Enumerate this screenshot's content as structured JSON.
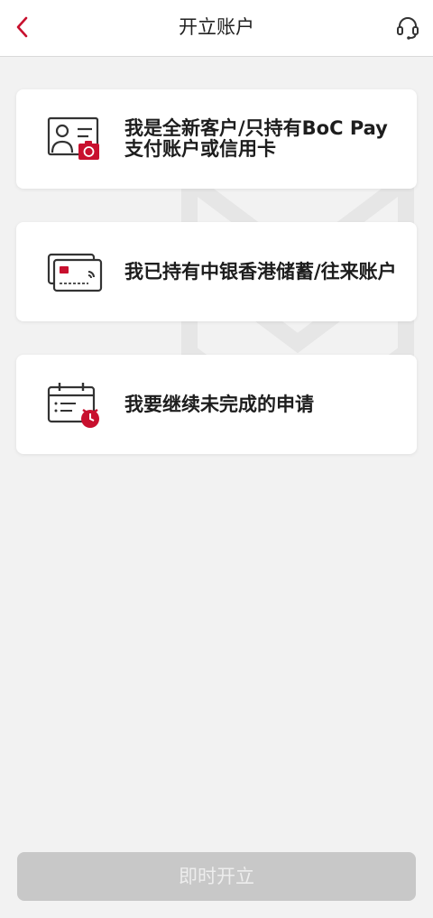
{
  "header": {
    "title": "开立账户",
    "back_icon": "chevron-left-icon",
    "support_icon": "headset-icon"
  },
  "options": [
    {
      "label": "我是全新客户/只持有BoC Pay支付账户或信用卡",
      "icon": "id-card-camera-icon"
    },
    {
      "label": "我已持有中银香港储蓄/往来账户",
      "icon": "bank-card-icon"
    },
    {
      "label": "我要继续未完成的申请",
      "icon": "calendar-clock-icon"
    }
  ],
  "footer": {
    "submit_label": "即时开立"
  },
  "colors": {
    "accent": "#c8102e",
    "disabled_button": "#c8c8c8",
    "background": "#f2f2f2"
  }
}
